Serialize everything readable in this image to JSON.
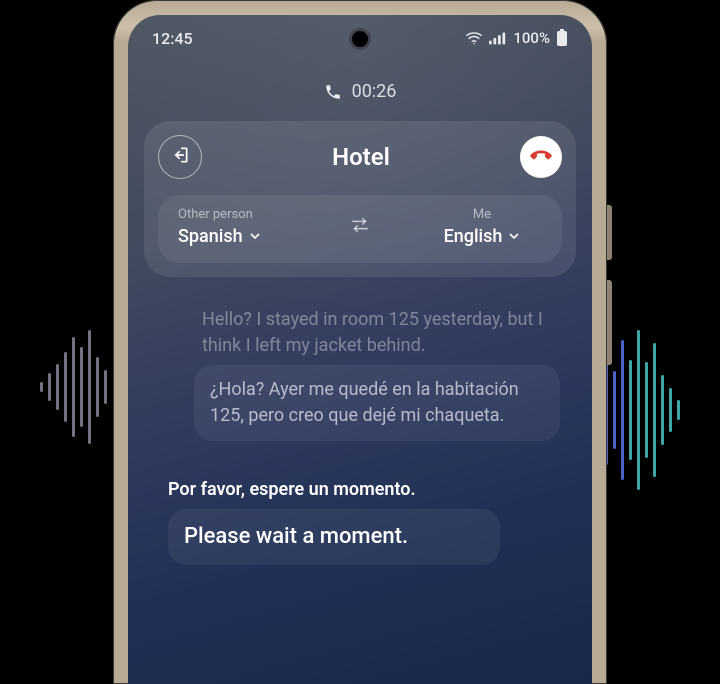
{
  "status": {
    "time": "12:45",
    "battery": "100%"
  },
  "call": {
    "duration": "00:26",
    "contact": "Hotel"
  },
  "lang": {
    "other_label": "Other person",
    "other_value": "Spanish",
    "me_label": "Me",
    "me_value": "English"
  },
  "transcript": {
    "me_original": "Hello? I stayed in room 125 yesterday, but I think I left my jacket behind.",
    "me_translated": "¿Hola? Ayer me quedé en la habitación 125, pero creo que dejé mi chaqueta.",
    "other_original": "Por favor, espere un momento.",
    "other_translated": "Please wait a moment."
  },
  "icons": {
    "exit": "exit-icon",
    "end_call": "end-call-icon",
    "swap": "swap-icon",
    "phone": "phone-icon",
    "wifi": "wifi-icon",
    "signal": "signal-icon",
    "battery": "battery-icon",
    "chevron": "chevron-down-icon"
  }
}
